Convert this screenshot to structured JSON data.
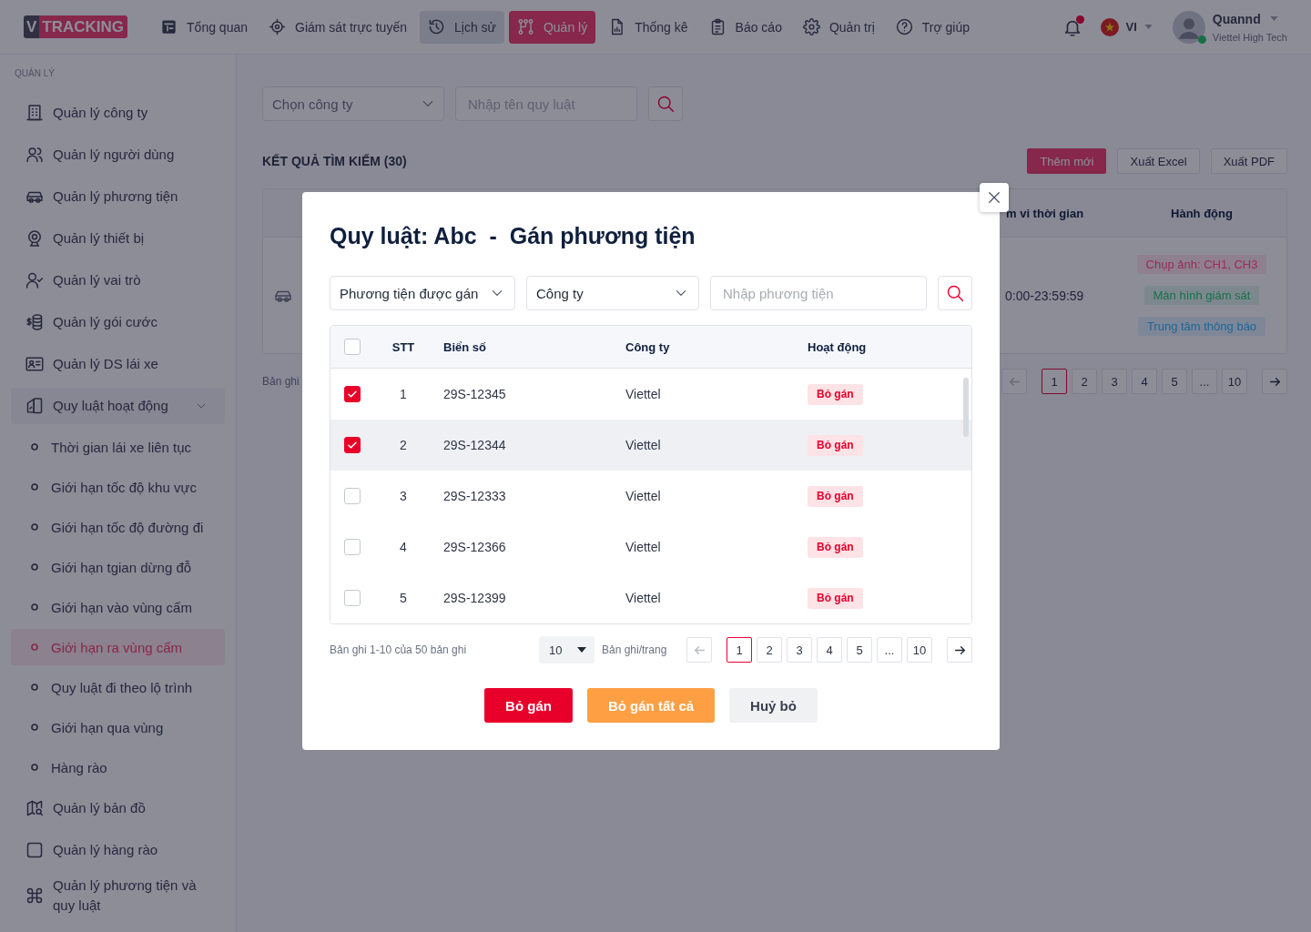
{
  "topbar": {
    "logo": {
      "prefix": "V",
      "name": "TRACKING"
    },
    "nav": [
      {
        "label": "Tổng quan",
        "selected": false,
        "hovered": false
      },
      {
        "label": "Giám sát trực tuyến",
        "selected": false,
        "hovered": false
      },
      {
        "label": "Lịch sử",
        "selected": false,
        "hovered": true
      },
      {
        "label": "Quản lý",
        "selected": true,
        "hovered": false
      },
      {
        "label": "Thống kê",
        "selected": false,
        "hovered": false
      },
      {
        "label": "Báo cáo",
        "selected": false,
        "hovered": false
      },
      {
        "label": "Quản trị",
        "selected": false,
        "hovered": false
      },
      {
        "label": "Trợ giúp",
        "selected": false,
        "hovered": false
      }
    ],
    "notifications": {
      "unread": true
    },
    "language": {
      "code": "VI"
    },
    "user": {
      "name": "Quannd",
      "company": "Viettel High Tech",
      "online": true
    }
  },
  "sidebar": {
    "section": "QUẢN LÝ",
    "items": [
      {
        "label": "Quản lý công ty",
        "selected": false
      },
      {
        "label": "Quản lý người dùng",
        "selected": false
      },
      {
        "label": "Quản lý phương tiện",
        "selected": false
      },
      {
        "label": "Quản lý thiết bị",
        "selected": false
      },
      {
        "label": "Quản lý vai trò",
        "selected": false
      },
      {
        "label": "Quản lý gói cước",
        "selected": false
      },
      {
        "label": "Quản lý DS lái xe",
        "selected": false
      },
      {
        "label": "Quy luật hoạt động",
        "expanded": true,
        "children": [
          {
            "label": "Thời gian lái xe liên tục",
            "selected": false
          },
          {
            "label": "Giới hạn tốc độ khu vực",
            "selected": false
          },
          {
            "label": "Giới hạn tốc độ đường đi",
            "selected": false
          },
          {
            "label": "Giới hạn tgian dừng đỗ",
            "selected": false
          },
          {
            "label": "Giới hạn vào vùng cấm",
            "selected": false
          },
          {
            "label": "Giới hạn ra vùng cấm",
            "selected": true
          },
          {
            "label": "Quy luật đi theo lộ trình",
            "selected": false
          },
          {
            "label": "Giới hạn qua vùng",
            "selected": false
          },
          {
            "label": "Hàng rào",
            "selected": false
          }
        ]
      },
      {
        "label": "Quản lý bản đồ",
        "selected": false
      },
      {
        "label": "Quản lý hàng rào",
        "selected": false
      },
      {
        "label": "Quản lý phương tiện và quy luật",
        "selected": false
      }
    ]
  },
  "main": {
    "filters": {
      "company": {
        "placeholder": "Chọn công ty"
      },
      "rule_name": {
        "placeholder": "Nhập tên quy luật"
      }
    },
    "results_title": "KẾT QUẢ TÌM KIẾM (30)",
    "actions": [
      {
        "label": "Thêm mới",
        "kind": "primary"
      },
      {
        "label": "Xuất Excel",
        "kind": "outline"
      },
      {
        "label": "Xuất PDF",
        "kind": "outline"
      }
    ],
    "table": {
      "columns": [
        "m vi thời gian",
        "Hành động"
      ],
      "rows": [
        {
          "column_1": "0:00-23:59:59",
          "tags": [
            {
              "label": "Chụp ảnh: CH1, CH3",
              "color": "#9a2d57"
            },
            {
              "label": "Màn hình giám sát",
              "color": "#17704a"
            },
            {
              "label": "Trung tâm thông báo",
              "color": "#1f6699"
            }
          ]
        }
      ]
    },
    "records": "Bản ghi",
    "pagination": {
      "previous": {
        "disabled": true
      },
      "pages": [
        {
          "label": "1",
          "selected": true
        },
        {
          "label": "2",
          "selected": false
        },
        {
          "label": "3",
          "selected": false
        },
        {
          "label": "4",
          "selected": false
        },
        {
          "label": "5",
          "selected": false
        },
        {
          "label": "...",
          "selected": false
        },
        {
          "label": "10",
          "selected": false
        }
      ],
      "next": {
        "disabled": false
      }
    }
  },
  "modal": {
    "title": "Quy luật: Abc  -  Gán phương tiện",
    "filters": {
      "assignment": {
        "value": "Phương tiện được gán"
      },
      "company": {
        "value": "Công ty"
      },
      "vehicle": {
        "placeholder": "Nhập phương tiện"
      }
    },
    "table": {
      "select_all": {
        "checked": false
      },
      "columns": [
        "STT",
        "Biển số",
        "Công ty",
        "Hoạt động"
      ],
      "rows": [
        {
          "checked": true,
          "hovered": false,
          "number": "1",
          "plate": "29S-12345",
          "company": "Viettel",
          "action": "Bỏ gán"
        },
        {
          "checked": true,
          "hovered": true,
          "number": "2",
          "plate": "29S-12344",
          "company": "Viettel",
          "action": "Bỏ gán"
        },
        {
          "checked": false,
          "hovered": false,
          "number": "3",
          "plate": "29S-12333",
          "company": "Viettel",
          "action": "Bỏ gán"
        },
        {
          "checked": false,
          "hovered": false,
          "number": "4",
          "plate": "29S-12366",
          "company": "Viettel",
          "action": "Bỏ gán"
        },
        {
          "checked": false,
          "hovered": false,
          "number": "5",
          "plate": "29S-12399",
          "company": "Viettel",
          "action": "Bỏ gán"
        }
      ]
    },
    "summary": "Bản ghi 1-10 của 50 bản ghi",
    "page_size": {
      "value": "10",
      "label": "Bản ghi/trang"
    },
    "pagination": {
      "previous": {
        "disabled": true
      },
      "pages": [
        {
          "label": "1",
          "selected": true
        },
        {
          "label": "2",
          "selected": false
        },
        {
          "label": "3",
          "selected": false
        },
        {
          "label": "4",
          "selected": false
        },
        {
          "label": "5",
          "selected": false
        },
        {
          "label": "...",
          "selected": false
        },
        {
          "label": "10",
          "selected": false
        }
      ],
      "next": {
        "disabled": false
      }
    },
    "buttons": [
      {
        "label": "Bỏ gán",
        "kind": "danger"
      },
      {
        "label": "Bỏ gán tất cả",
        "kind": "warning"
      },
      {
        "label": "Huỷ bỏ",
        "kind": "secondary"
      }
    ]
  }
}
